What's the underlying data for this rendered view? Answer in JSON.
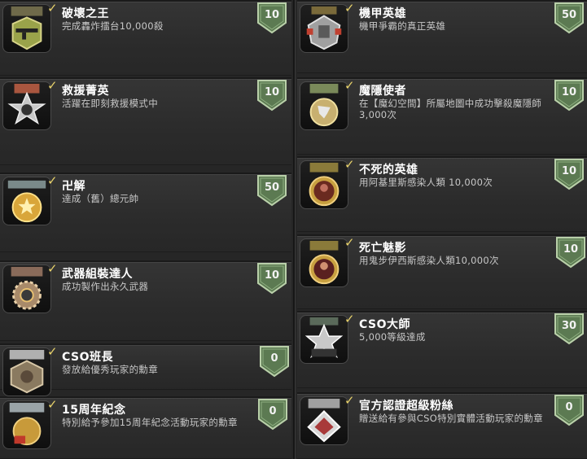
{
  "colors": {
    "background": "#262626",
    "card": "#303030",
    "badge_fill": "#5c7a52",
    "badge_border": "#b9d0a9",
    "check": "#e8d26a",
    "title": "#ffffff",
    "desc": "#c7c7c7"
  },
  "achievements_left": [
    {
      "title": "破壞之王",
      "desc": "完成轟炸擂台10,000殺",
      "points": "10",
      "icon": "gun-medal-icon"
    },
    {
      "title": "救援菁英",
      "desc": "活躍在即刻救援模式中",
      "points": "10",
      "icon": "star-medal-icon"
    },
    {
      "title": "卍解",
      "desc": "達成（舊）總元帥",
      "points": "50",
      "icon": "gold-rank-medal-icon"
    },
    {
      "title": "武器組裝達人",
      "desc": "成功製作出永久武器",
      "points": "10",
      "icon": "gear-medal-icon"
    },
    {
      "title": "CSO班長",
      "desc": "發放給優秀玩家的勳章",
      "points": "0",
      "icon": "squad-leader-medal-icon"
    },
    {
      "title": "15周年紀念",
      "desc": "特別給予參加15周年紀念活動玩家的勳章",
      "points": "0",
      "icon": "anniversary-medal-icon"
    }
  ],
  "achievements_right": [
    {
      "title": "機甲英雄",
      "desc": "機甲爭霸的真正英雄",
      "points": "50",
      "icon": "mecha-medal-icon"
    },
    {
      "title": "魔隱使者",
      "desc": "在【魔幻空間】所屬地圖中成功擊殺魔隱師3,000次",
      "points": "10",
      "icon": "eagle-medal-icon"
    },
    {
      "title": "不死的英雄",
      "desc": "用阿基里斯感染人類 10,000次",
      "points": "10",
      "icon": "zombie-hero-medal-icon"
    },
    {
      "title": "死亡魅影",
      "desc": "用鬼步伊西斯感染人類10,000次",
      "points": "10",
      "icon": "phantom-medal-icon"
    },
    {
      "title": "CSO大師",
      "desc": "5,000等級達成",
      "points": "30",
      "icon": "master-5000-medal-icon"
    },
    {
      "title": "官方認證超級粉絲",
      "desc": "贈送給有參與CSO特別實體活動玩家的勳章",
      "points": "0",
      "icon": "super-fan-medal-icon"
    }
  ]
}
